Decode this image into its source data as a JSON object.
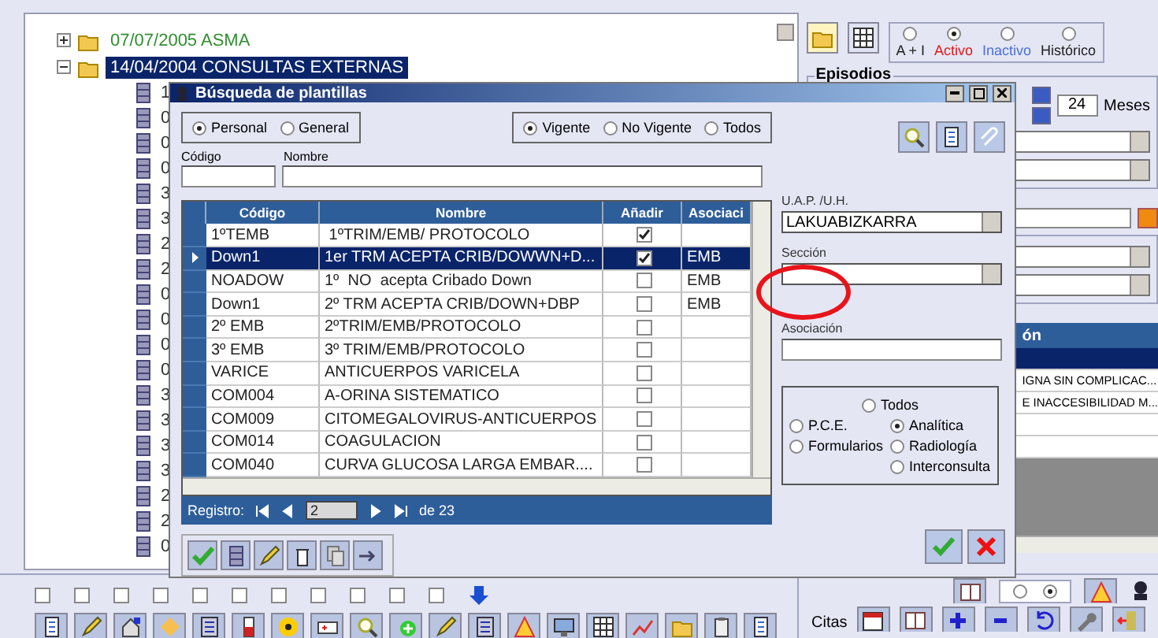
{
  "tree": {
    "items": [
      {
        "label": "07/07/2005  ASMA",
        "selected": false,
        "expanded": false
      },
      {
        "label": "14/04/2004  CONSULTAS EXTERNAS",
        "selected": true,
        "expanded": true,
        "children": [
          {
            "label": "1"
          },
          {
            "label": "0"
          },
          {
            "label": "0"
          },
          {
            "label": "0"
          },
          {
            "label": "3"
          },
          {
            "label": "3"
          },
          {
            "label": "2"
          },
          {
            "label": "2"
          },
          {
            "label": "0"
          },
          {
            "label": "0"
          },
          {
            "label": "0"
          },
          {
            "label": "0"
          },
          {
            "label": "3"
          },
          {
            "label": "3"
          },
          {
            "label": "3"
          },
          {
            "label": "3"
          },
          {
            "label": "2"
          },
          {
            "label": "2"
          },
          {
            "label": "0"
          }
        ]
      }
    ]
  },
  "view_modes": [
    {
      "selected": true
    },
    {
      "selected": false
    }
  ],
  "status_filter": [
    {
      "label": "A + I",
      "selected": false,
      "color": "#202020"
    },
    {
      "label": "Activo",
      "selected": true,
      "color": "#e01818"
    },
    {
      "label": "Inactivo",
      "selected": false,
      "color": "#4a6ee0"
    },
    {
      "label": "Histórico",
      "selected": false,
      "color": "#202020"
    }
  ],
  "episodes": {
    "title": "Episodios",
    "months": "24",
    "months_label": "Meses"
  },
  "side_table": {
    "header": "ón",
    "rows": [
      {
        "selected": true
      },
      {
        "text": "IGNA SIN COMPLICAC...",
        "selected": false
      },
      {
        "text": "E INACCESIBILIDAD M...",
        "selected": false
      },
      {
        "selected": false
      },
      {
        "selected": false
      }
    ]
  },
  "dialog": {
    "title": "Búsqueda de plantillas",
    "owner_filter": [
      {
        "label": "Personal",
        "selected": true
      },
      {
        "label": "General",
        "selected": false
      }
    ],
    "validity_filter": [
      {
        "label": "Vigente",
        "selected": true
      },
      {
        "label": "No Vigente",
        "selected": false
      },
      {
        "label": "Todos",
        "selected": false
      }
    ],
    "code_label": "Código",
    "name_label": "Nombre",
    "table": {
      "columns": [
        "Código",
        "Nombre",
        "Añadir",
        "Asociaci"
      ],
      "rows": [
        {
          "code": "1ºTEMB",
          "name": " 1ºTRIM/EMB/ PROTOCOLO",
          "added": true,
          "selected": false
        },
        {
          "code": "Down1",
          "name": "1er TRM ACEPTA CRIB/DOWWN+D...",
          "added": true,
          "association": "EMB",
          "selected": true
        },
        {
          "code": "NOADOW",
          "name": "1º  NO  acepta Cribado Down",
          "added": false,
          "association": "EMB",
          "selected": false
        },
        {
          "code": "Down1",
          "name": "2º TRM ACEPTA CRIB/DOWN+DBP",
          "added": false,
          "association": "EMB",
          "selected": false
        },
        {
          "code": "2º EMB",
          "name": "2ºTRIM/EMB/PROTOCOLO",
          "added": false,
          "selected": false
        },
        {
          "code": "3º EMB",
          "name": "3º TRIM/EMB/PROTOCOLO",
          "added": false,
          "selected": false
        },
        {
          "code": "VARICE",
          "name": "ANTICUERPOS VARICELA",
          "added": false,
          "selected": false
        },
        {
          "code": "COM004",
          "name": "A-ORINA SISTEMATICO",
          "added": false,
          "selected": false
        },
        {
          "code": "COM009",
          "name": "CITOMEGALOVIRUS-ANTICUERPOS",
          "added": false,
          "selected": false
        },
        {
          "code": "COM014",
          "name": "COAGULACION",
          "added": false,
          "selected": false
        },
        {
          "code": "COM040",
          "name": "CURVA GLUCOSA LARGA EMBAR....",
          "added": false,
          "selected": false
        }
      ]
    },
    "navigator": {
      "label": "Registro:",
      "value": "2",
      "total": "de 23"
    },
    "uap": {
      "label": "U.A.P. /U.H.",
      "value": "LAKUABIZKARRA"
    },
    "section": {
      "label": "Sección"
    },
    "association": {
      "label": "Asociación"
    },
    "type_filter": [
      {
        "label": "Todos",
        "selected": false
      },
      {
        "label": "P.C.E.",
        "selected": false
      },
      {
        "label": "Analítica",
        "selected": true
      },
      {
        "label": "Formularios",
        "selected": false
      },
      {
        "label": "Radiología",
        "selected": false
      },
      {
        "label": "Interconsulta",
        "selected": false
      }
    ]
  },
  "bottom": {
    "checkboxes": [
      {
        "checked": false
      },
      {
        "checked": false
      },
      {
        "checked": false
      },
      {
        "checked": false
      },
      {
        "checked": false
      },
      {
        "checked": false
      },
      {
        "checked": false
      },
      {
        "checked": false
      },
      {
        "checked": false
      },
      {
        "checked": false
      },
      {
        "checked": false
      }
    ],
    "appointments_label": "Citas",
    "mode_radios": [
      {
        "selected": false
      },
      {
        "selected": true
      }
    ]
  }
}
